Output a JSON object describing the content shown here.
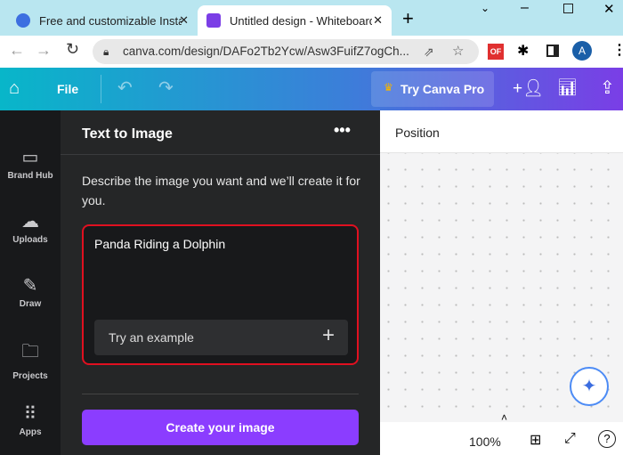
{
  "browser": {
    "tabs": [
      {
        "title": "Free and customizable Instag"
      },
      {
        "title": "Untitled design - Whiteboard"
      }
    ],
    "url": "canva.com/design/DAFo2Tb2Ycw/Asw3FuifZ7ogCh...",
    "profile_initial": "A",
    "ext_badge": "OF"
  },
  "toolbar": {
    "file": "File",
    "try_pro": "Try Canva Pro"
  },
  "sidebar": {
    "items": [
      {
        "label": "Brand Hub"
      },
      {
        "label": "Uploads"
      },
      {
        "label": "Draw"
      },
      {
        "label": "Projects"
      },
      {
        "label": "Apps"
      }
    ]
  },
  "panel": {
    "title": "Text to Image",
    "description": "Describe the image you want and we’ll create it for you.",
    "prompt_value": "Panda Riding a Dolphin",
    "try_example": "Try an example",
    "create_button": "Create your image"
  },
  "canvas": {
    "position_label": "Position",
    "zoom": "100%"
  },
  "colors": {
    "accent": "#8b3dff",
    "highlight": "#e01020"
  }
}
